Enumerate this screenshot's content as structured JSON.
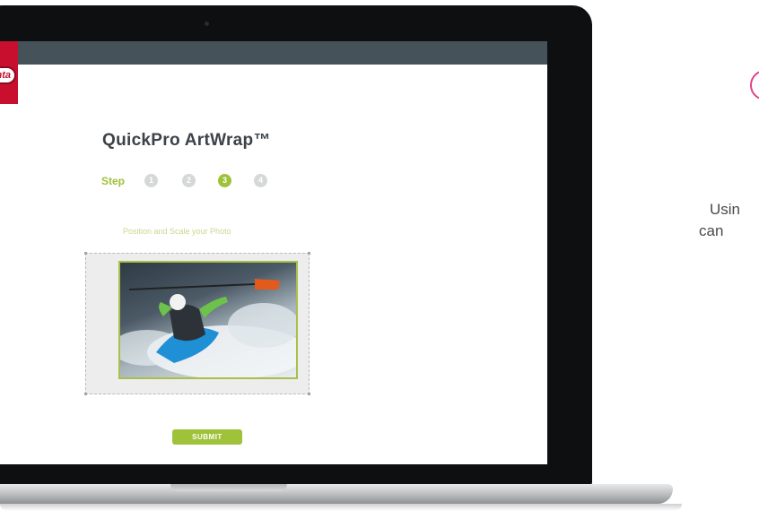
{
  "brand": {
    "logo_text": "nta"
  },
  "app": {
    "title": "QuickPro ArtWrap™",
    "step_label": "Step",
    "steps": [
      "1",
      "2",
      "3",
      "4"
    ],
    "active_step": 3,
    "instruction": "Position and Scale your Photo",
    "submit_label": "SUBMIT"
  },
  "side": {
    "line1": "Usin",
    "line2": "can"
  },
  "colors": {
    "accent_green": "#9ec23a",
    "topbar": "#45525a",
    "brand_red": "#c8102e",
    "pink": "#e0428a"
  }
}
